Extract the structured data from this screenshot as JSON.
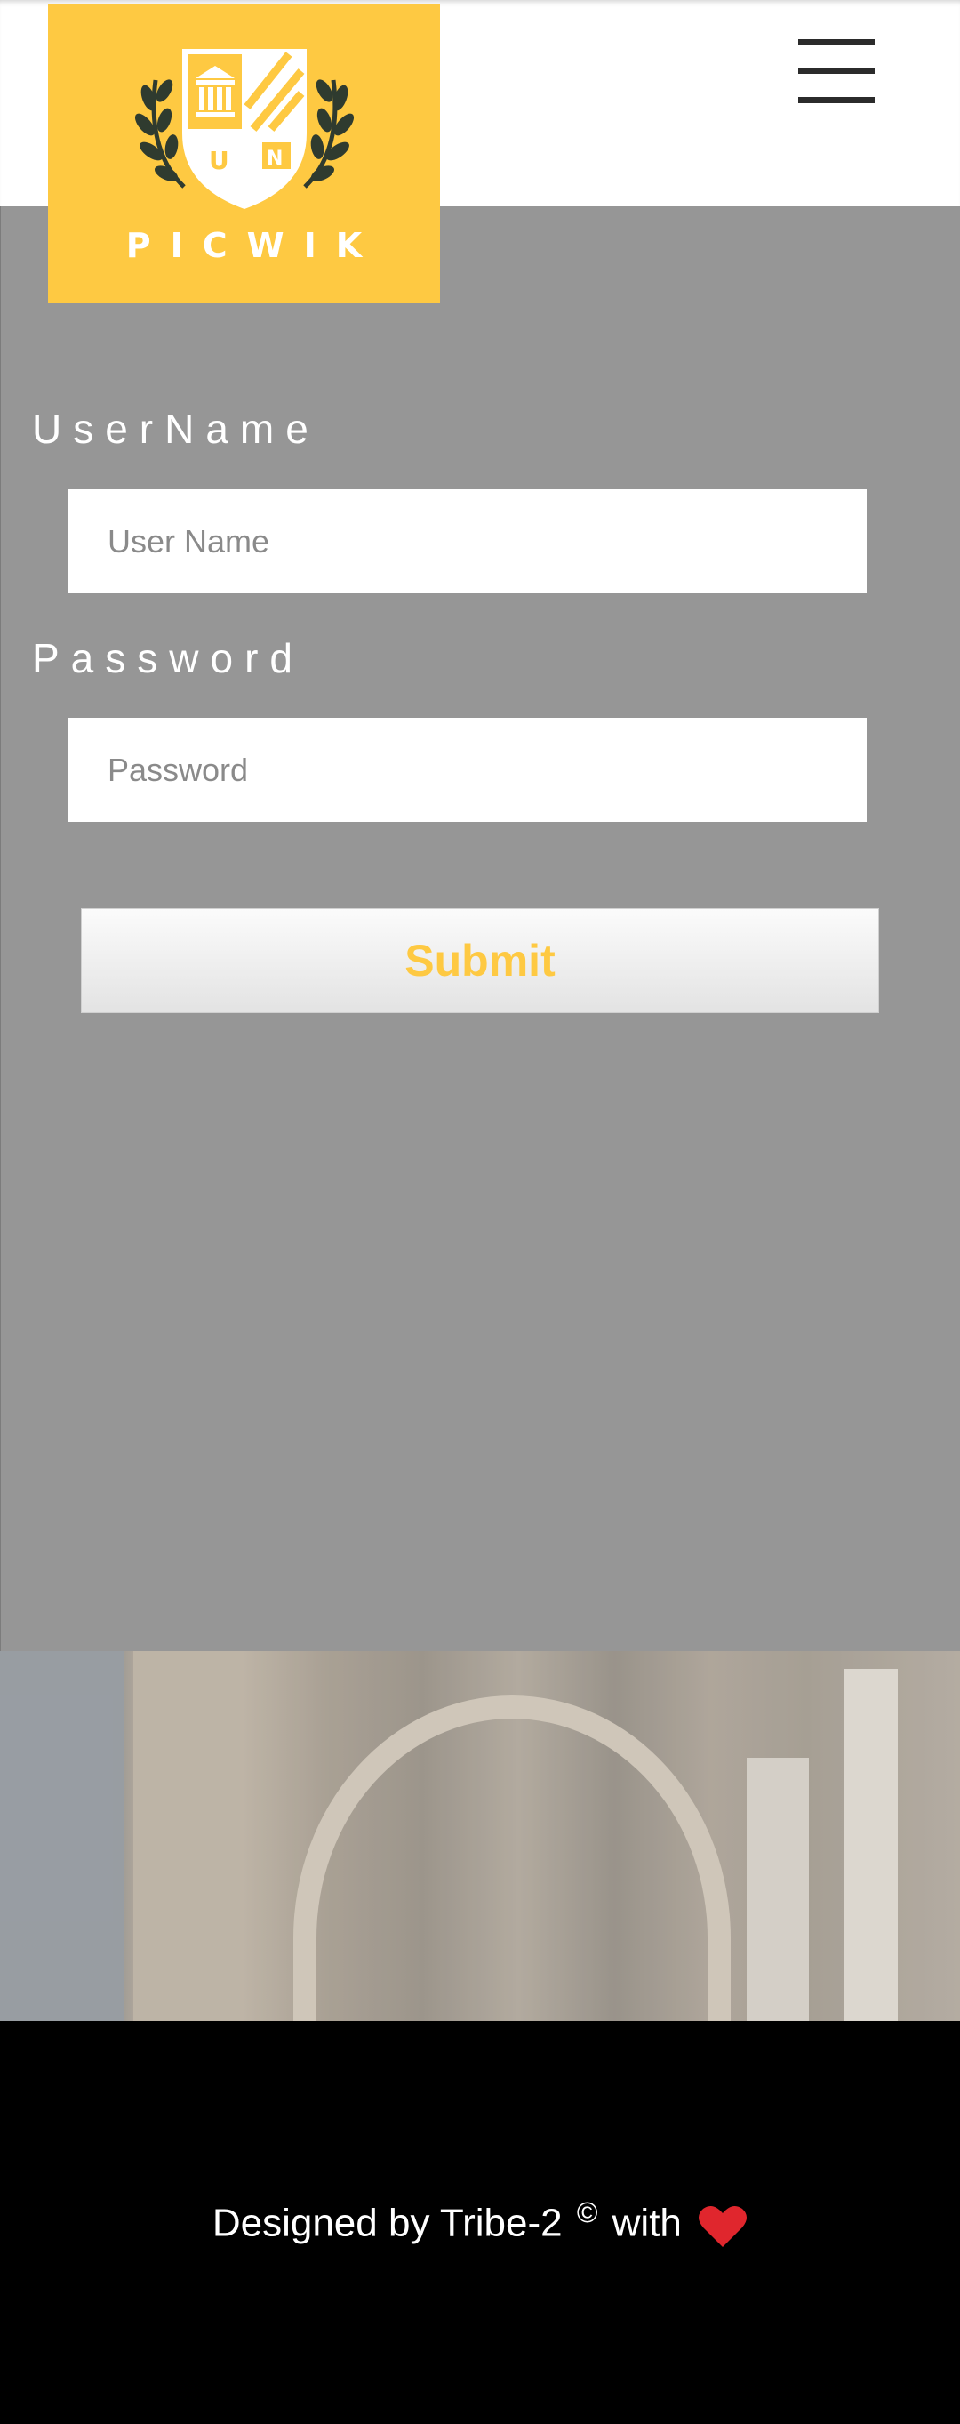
{
  "header": {
    "logo_text": "PICWIK",
    "logo_color": "#fec942",
    "menu_icon": "hamburger-menu-icon"
  },
  "form": {
    "username_label": "UserName",
    "username_placeholder": "User Name",
    "password_label": "Password",
    "password_placeholder": "Password",
    "submit_label": "Submit",
    "panel_color": "#969696",
    "submit_text_color": "#fec942"
  },
  "footer": {
    "text_before": "Designed by Tribe-2",
    "copyright_symbol": "©",
    "text_after": "with",
    "heart_icon": "heart-icon"
  }
}
